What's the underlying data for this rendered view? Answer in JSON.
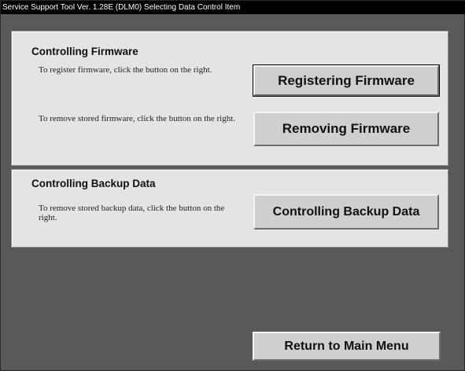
{
  "window": {
    "title": "Service Support Tool Ver. 1.28E (DLM0)   Selecting Data Control Item"
  },
  "firmware": {
    "title": "Controlling Firmware",
    "register_desc": "To register firmware, click the button on the right.",
    "register_button": "Registering Firmware",
    "remove_desc": "To remove stored firmware, click the button on the right.",
    "remove_button": "Removing Firmware"
  },
  "backup": {
    "title": "Controlling Backup Data",
    "remove_desc": "To remove stored backup data, click the button on the right.",
    "button": "Controlling Backup Data"
  },
  "footer": {
    "return_button": "Return to Main Menu"
  }
}
